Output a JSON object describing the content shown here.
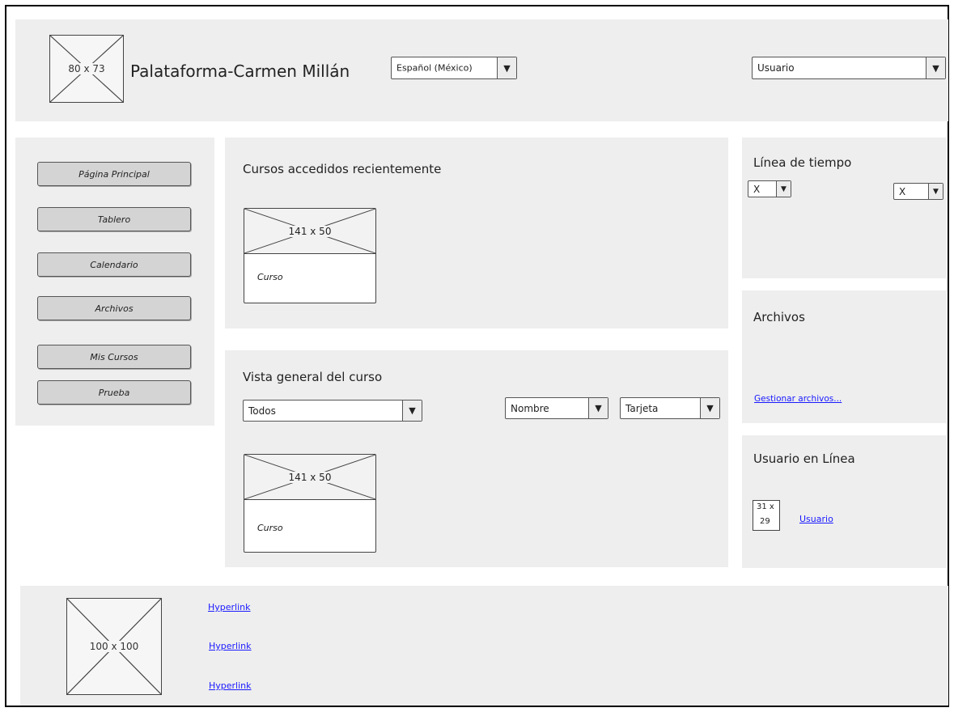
{
  "header": {
    "logo_label": "80 x 73",
    "title": "Palataforma-Carmen Millán",
    "language_select": {
      "value": "Español (México)"
    },
    "user_select": {
      "value": "Usuario"
    }
  },
  "sidebar": {
    "items": [
      {
        "label": "Página Principal"
      },
      {
        "label": "Tablero"
      },
      {
        "label": "Calendario"
      },
      {
        "label": "Archivos"
      },
      {
        "label": "Mis Cursos"
      },
      {
        "label": "Prueba"
      }
    ]
  },
  "recent_courses": {
    "heading": "Cursos accedidos recientemente",
    "card": {
      "image_label": "141 x 50",
      "text": "Curso"
    }
  },
  "course_overview": {
    "heading": "Vista general del curso",
    "filter_select": {
      "value": "Todos"
    },
    "sort_select": {
      "value": "Nombre"
    },
    "view_select": {
      "value": "Tarjeta"
    },
    "card": {
      "image_label": "141 x 50",
      "text": "Curso"
    }
  },
  "timeline": {
    "heading": "Línea de tiempo",
    "left_select": {
      "value": "X"
    },
    "right_select": {
      "value": "X"
    }
  },
  "files": {
    "heading": "Archivos",
    "manage_link": "Gestionar archivos..."
  },
  "online_users": {
    "heading": "Usuario en Línea",
    "avatar_label_line1": "31 x",
    "avatar_label_line2": "29",
    "user_link": "Usuario"
  },
  "footer": {
    "logo_label": "100 x 100",
    "links": [
      "Hyperlink",
      "Hyperlink",
      "Hyperlink"
    ]
  },
  "icons": {
    "dropdown_arrow": "▼"
  },
  "colors": {
    "panel_bg": "#eeeeee",
    "link": "#1a1aff",
    "button_bg": "#d4d4d4"
  }
}
